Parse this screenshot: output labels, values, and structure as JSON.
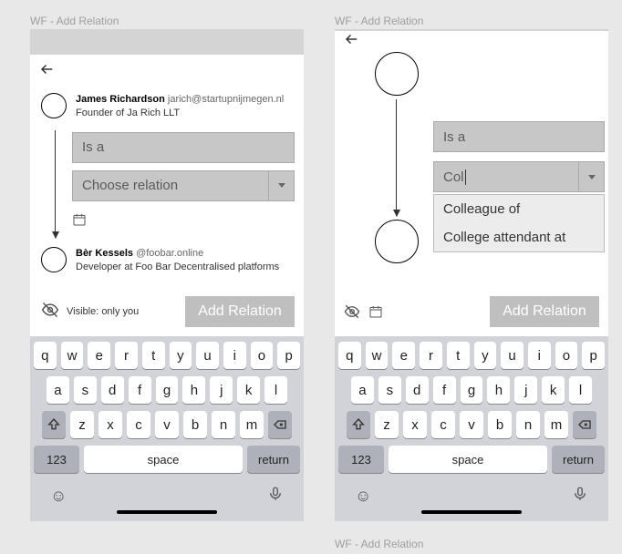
{
  "frame_labels": {
    "left": "WF - Add Relation",
    "right": "WF - Add Relation",
    "bottom": "WF - Add Relation"
  },
  "left": {
    "person_top": {
      "name": "James Richardson",
      "handle": "jarich@startupnijmegen.nl",
      "subtitle": "Founder of Ja Rich LLT"
    },
    "field_isa": "Is a",
    "field_relation_placeholder": "Choose relation",
    "person_bottom": {
      "name": "Bèr Kessels",
      "handle": "@foobar.online",
      "subtitle": "Developer at Foo Bar Decentralised platforms"
    },
    "visibility_text": "Visible: only you",
    "primary_button": "Add Relation"
  },
  "right": {
    "field_isa": "Is a",
    "field_relation_typed": "Col",
    "suggestions": [
      "Colleague of",
      "College attendant at"
    ],
    "primary_button": "Add Relation"
  },
  "keyboard": {
    "row1": [
      "q",
      "w",
      "e",
      "r",
      "t",
      "y",
      "u",
      "i",
      "o",
      "p"
    ],
    "row2": [
      "a",
      "s",
      "d",
      "f",
      "g",
      "h",
      "j",
      "k",
      "l"
    ],
    "row3": [
      "z",
      "x",
      "c",
      "v",
      "b",
      "n",
      "m"
    ],
    "key_123": "123",
    "key_space": "space",
    "key_return": "return"
  }
}
